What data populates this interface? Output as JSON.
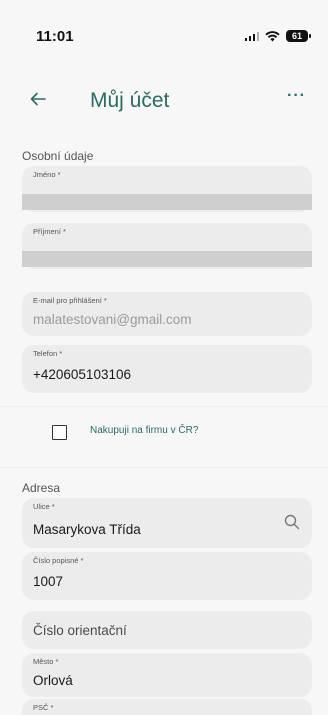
{
  "status": {
    "time": "11:01",
    "battery": "61"
  },
  "header": {
    "title": "Můj účet",
    "more": "···"
  },
  "personal": {
    "title": "Osobní údaje",
    "first_name_label": "Jméno *",
    "last_name_label": "Příjmení *",
    "email_label": "E-mail pro přihlášení *",
    "email_value": "malatestovani@gmail.com",
    "phone_label": "Telefon *",
    "phone_value": "+420605103106"
  },
  "company": {
    "label": "Nakupuji na firmu v ČR?",
    "checked": false
  },
  "address": {
    "title": "Adresa",
    "street_label": "Ulice *",
    "street_value": "Masarykova Třída",
    "house_number_label": "Číslo popisné *",
    "house_number_value": "1007",
    "orientation_placeholder": "Číslo orientační",
    "city_label": "Město *",
    "city_value": "Orlová",
    "zip_label": "PSČ *"
  },
  "colors": {
    "accent": "#2c6b64",
    "field_bg": "#ececec",
    "page_bg": "#f7f7f7"
  }
}
